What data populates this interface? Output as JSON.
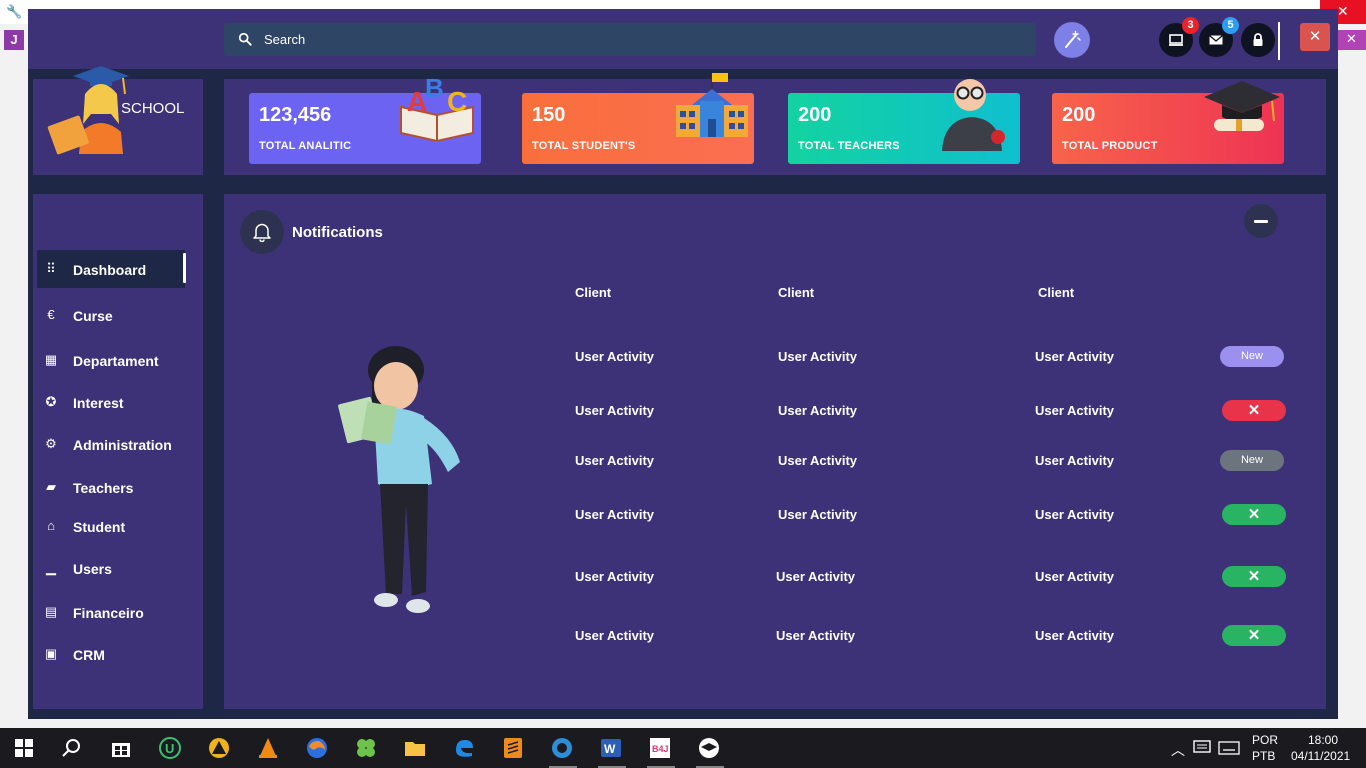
{
  "header": {
    "search_placeholder": "Search",
    "notifications_badge": "3",
    "messages_badge": "5",
    "close_label": "✕"
  },
  "logo": {
    "text": "SCHOOL"
  },
  "stats": [
    {
      "value": "123,456",
      "label": "TOTAL ANALITIC",
      "color": "#6c63f2",
      "icon": "abc-book-icon"
    },
    {
      "value": "150",
      "label": "TOTAL STUDENT'S",
      "color": "#f96f3b",
      "icon": "school-building-icon"
    },
    {
      "value": "200",
      "label": "TOTAL TEACHERS",
      "color": "#13c8a8",
      "icon": "teacher-icon"
    },
    {
      "value": "200",
      "label": "TOTAL PRODUCT",
      "color": "#f7564a",
      "icon": "graduation-cap-icon"
    }
  ],
  "sidebar": {
    "items": [
      {
        "label": "Dashboard",
        "icon": "grid-icon",
        "glyph": "⠿",
        "active": true
      },
      {
        "label": "Curse",
        "icon": "euro-icon",
        "glyph": "€"
      },
      {
        "label": "Departament",
        "icon": "calendar-icon",
        "glyph": "▦"
      },
      {
        "label": "Interest",
        "icon": "handshake-icon",
        "glyph": "✪"
      },
      {
        "label": "Administration",
        "icon": "gears-icon",
        "glyph": "⚙"
      },
      {
        "label": "Teachers",
        "icon": "folder-icon",
        "glyph": "▰"
      },
      {
        "label": "Student",
        "icon": "university-icon",
        "glyph": "⌂"
      },
      {
        "label": "Users",
        "icon": "signal-icon",
        "glyph": "▁"
      },
      {
        "label": "Financeiro",
        "icon": "book-icon",
        "glyph": "▤"
      },
      {
        "label": "CRM",
        "icon": "briefcase-icon",
        "glyph": "▣"
      }
    ]
  },
  "notifications": {
    "title": "Notifications",
    "columns": [
      "Client",
      "Client",
      "Client"
    ],
    "rows": [
      {
        "cells": [
          "User Activity",
          "User Activity",
          "User Activity"
        ],
        "status": "New",
        "status_type": "new-purple",
        "status_color": "#9b8fef"
      },
      {
        "cells": [
          "User Activity",
          "User Activity",
          "User Activity"
        ],
        "status": "✕",
        "status_type": "x-red",
        "status_color": "#e8334a"
      },
      {
        "cells": [
          "User Activity",
          "User Activity",
          "User Activity"
        ],
        "status": "New",
        "status_type": "new-gray",
        "status_color": "#6c757d"
      },
      {
        "cells": [
          "User Activity",
          "User Activity",
          "User Activity"
        ],
        "status": "✕",
        "status_type": "x-green",
        "status_color": "#28b463"
      },
      {
        "cells": [
          "User Activity",
          "User Activity",
          "User Activity"
        ],
        "status": "✕",
        "status_type": "x-green",
        "status_color": "#28b463"
      },
      {
        "cells": [
          "User Activity",
          "User Activity",
          "User Activity"
        ],
        "status": "✕",
        "status_type": "x-green",
        "status_color": "#28b463"
      }
    ]
  },
  "taskbar": {
    "language": "POR",
    "layout": "PTB",
    "time": "18:00",
    "date": "04/11/2021"
  }
}
